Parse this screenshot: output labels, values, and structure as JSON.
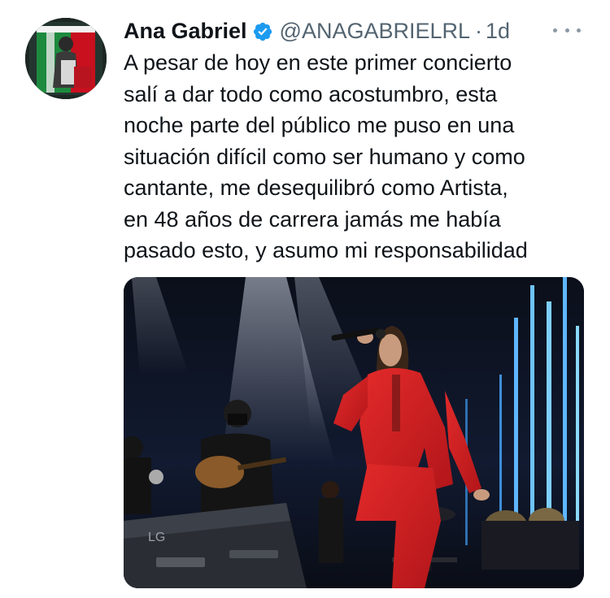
{
  "tweet": {
    "display_name": "Ana Gabriel",
    "handle": "@ANAGABRIELRL",
    "separator": "·",
    "timestamp": "1d",
    "verified_icon": "verified-badge-icon",
    "more_icon": "more-options-icon",
    "text_lines": [
      "A pesar de hoy en este primer concierto",
      "salí a dar todo como acostumbro, esta",
      "noche parte del público me puso en una",
      "situación difícil como ser humano y como",
      "cantante, me desequilibró como Artista,",
      "en 48 años de carrera jamás me había",
      "pasado esto, y asumo mi responsabilidad"
    ],
    "media": {
      "keyboard_brand": "LG"
    }
  },
  "colors": {
    "text": "#0f1419",
    "secondary": "#536471",
    "verified_blue": "#1d9bf0",
    "outfit_red": "#d21f1f"
  }
}
